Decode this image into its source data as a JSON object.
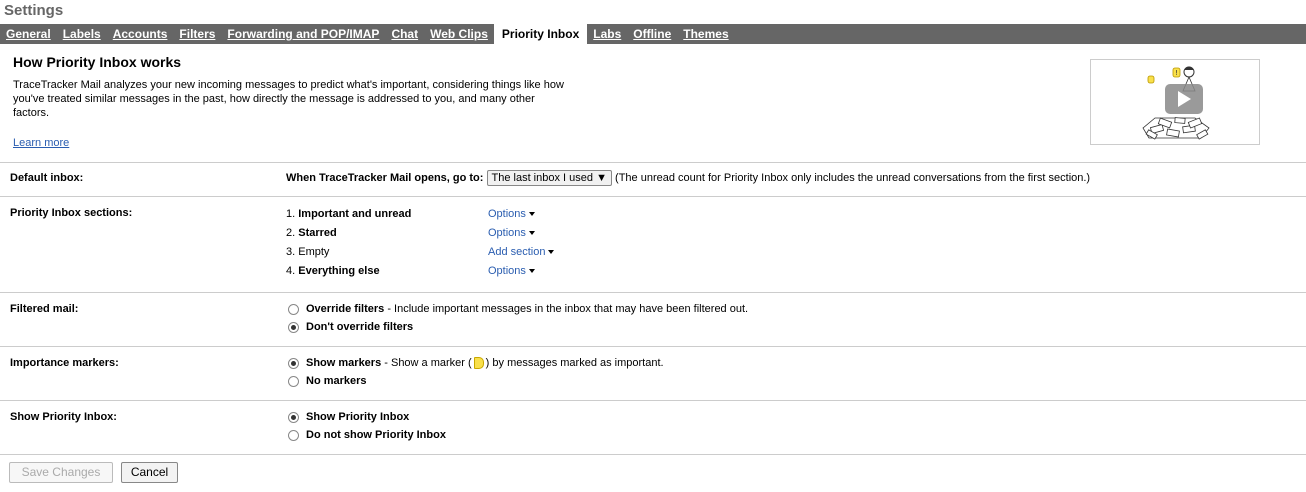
{
  "page": {
    "title": "Settings"
  },
  "tabs": [
    {
      "label": "General"
    },
    {
      "label": "Labels"
    },
    {
      "label": "Accounts"
    },
    {
      "label": "Filters"
    },
    {
      "label": "Forwarding and POP/IMAP"
    },
    {
      "label": "Chat"
    },
    {
      "label": "Web Clips"
    },
    {
      "label": "Priority Inbox",
      "active": true
    },
    {
      "label": "Labs"
    },
    {
      "label": "Offline"
    },
    {
      "label": "Themes"
    }
  ],
  "header": {
    "title": "How Priority Inbox works",
    "description": "TraceTracker Mail analyzes your new incoming messages to predict what's important, considering things like how you've treated similar messages in the past, how directly the message is addressed to you, and many other factors.",
    "learn_more": "Learn more",
    "video_icon": "play-video-icon"
  },
  "default_inbox": {
    "label": "Default inbox:",
    "prompt": "When TraceTracker Mail opens, go to:",
    "selected": "The last inbox I used",
    "note": "(The unread count for Priority Inbox only includes the unread conversations from the first section.)"
  },
  "sections": {
    "label": "Priority Inbox sections:",
    "items": [
      {
        "num": "1.",
        "name": "Important and unread",
        "action": "Options",
        "bold": true
      },
      {
        "num": "2.",
        "name": "Starred",
        "action": "Options",
        "bold": true
      },
      {
        "num": "3.",
        "name": "Empty",
        "action": "Add section",
        "bold": false
      },
      {
        "num": "4.",
        "name": "Everything else",
        "action": "Options",
        "bold": true
      }
    ]
  },
  "filtered_mail": {
    "label": "Filtered mail:",
    "opt1_bold": "Override filters",
    "opt1_rest": " - Include important messages in the inbox that may have been filtered out.",
    "opt2": "Don't override filters"
  },
  "importance": {
    "label": "Importance markers:",
    "opt1_bold": "Show markers",
    "opt1_pre": " - Show a marker (",
    "opt1_post": ") by messages marked as important.",
    "opt2": "No markers"
  },
  "show_pi": {
    "label": "Show Priority Inbox:",
    "opt1": "Show Priority Inbox",
    "opt2": "Do not show Priority Inbox"
  },
  "buttons": {
    "save": "Save Changes",
    "cancel": "Cancel"
  }
}
